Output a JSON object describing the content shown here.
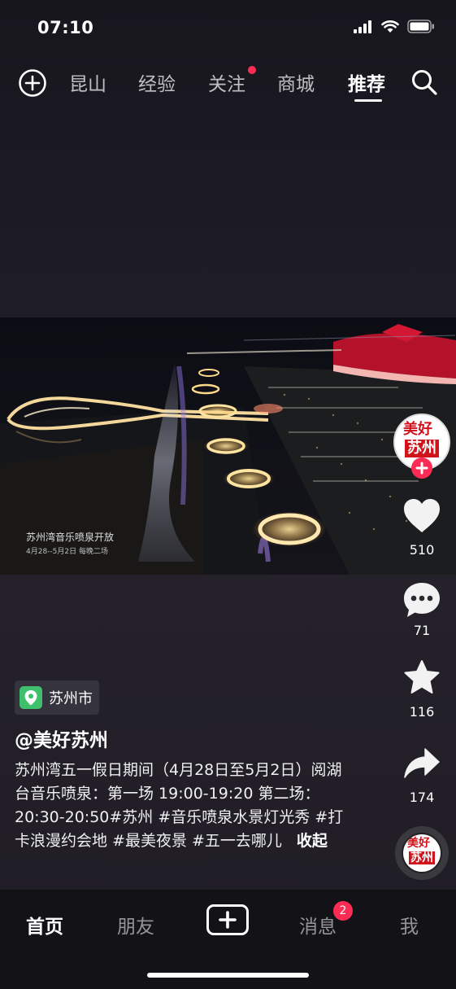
{
  "status_bar": {
    "time": "07:10"
  },
  "top_nav": {
    "tabs": [
      {
        "label": "昆山"
      },
      {
        "label": "经验"
      },
      {
        "label": "关注"
      },
      {
        "label": "商城"
      },
      {
        "label": "推荐"
      }
    ],
    "active_tab": "推荐"
  },
  "video": {
    "caption_title": "苏州湾音乐喷泉开放",
    "caption_sub": "4月28--5月2日  每晚二场"
  },
  "rail": {
    "avatar_text": [
      "美好",
      "苏州"
    ],
    "likes": "510",
    "comments": "71",
    "favorites": "116",
    "shares": "174",
    "music_text": [
      "美好",
      "苏州"
    ]
  },
  "post": {
    "location": "苏州市",
    "author": "@美好苏州",
    "description": "苏州湾五一假日期间（4月28日至5月2日）阅湖台音乐喷泉：第一场 19:00-19:20 第二场：20:30-20:50#苏州 #音乐喷泉水景灯光秀 #打卡浪漫约会地 #最美夜景 #五一去哪儿",
    "collapse_label": "收起"
  },
  "bottom_nav": {
    "home": "首页",
    "friends": "朋友",
    "messages": "消息",
    "messages_badge": "2",
    "me": "我"
  },
  "colors": {
    "accent_red": "#fe2c55",
    "background": "#1f1c24",
    "bottom_bar": "#131217"
  }
}
